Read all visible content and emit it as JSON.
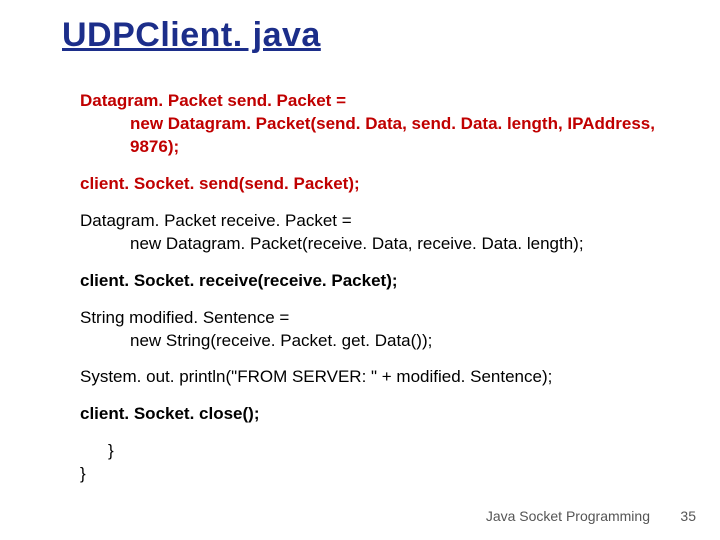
{
  "title": "UDPClient. java",
  "code": {
    "l1": "Datagram. Packet send. Packet =",
    "l2": "new Datagram. Packet(send. Data, send. Data. length, IPAddress, 9876);",
    "l3": "client. Socket. send(send. Packet);",
    "l4": "Datagram. Packet receive. Packet =",
    "l5": "new Datagram. Packet(receive. Data, receive. Data. length);",
    "l6": "client. Socket. receive(receive. Packet);",
    "l7": "String modified. Sentence =",
    "l8": "new String(receive. Packet. get. Data());",
    "l9": "System. out. println(\"FROM SERVER: \" + modified. Sentence);",
    "l10": "client. Socket. close();",
    "inner_brace": "}",
    "outer_brace": "}"
  },
  "footer": {
    "text": "Java Socket Programming",
    "page": "35"
  }
}
